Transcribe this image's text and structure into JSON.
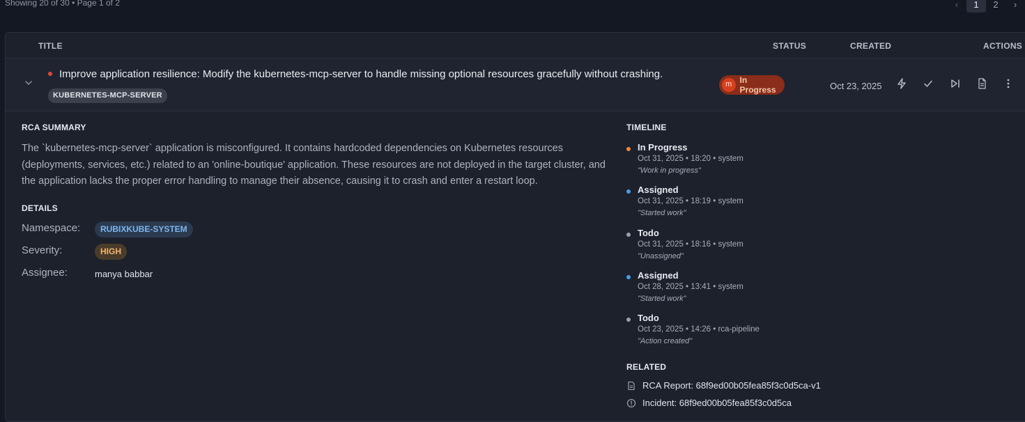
{
  "list_header": {
    "showing_text": "Showing 20 of 30 • Page 1 of 2",
    "pagination": {
      "prev": "‹",
      "pages": [
        "1",
        "2"
      ],
      "next": "›",
      "current": "1"
    }
  },
  "table": {
    "columns": {
      "title": "TITLE",
      "status": "STATUS",
      "created": "CREATED",
      "actions": "ACTIONS"
    }
  },
  "row": {
    "title": "Improve application resilience: Modify the kubernetes-mcp-server to handle missing optional resources gracefully without crashing.",
    "tag": "KUBERNETES-MCP-SERVER",
    "status": {
      "avatar_initial": "m",
      "label": "In Progress"
    },
    "created": "Oct 23, 2025",
    "actions": [
      "bolt-icon",
      "check-icon",
      "skip-forward-icon",
      "document-icon",
      "more-vertical-icon"
    ]
  },
  "details_panel": {
    "rca_summary_heading": "RCA SUMMARY",
    "rca_summary_text": "The `kubernetes-mcp-server` application is misconfigured. It contains hardcoded dependencies on Kubernetes resources (deployments, services, etc.) related to an 'online-boutique' application. These resources are not deployed in the target cluster, and the application lacks the proper error handling to manage their absence, causing it to crash and enter a restart loop.",
    "details_heading": "DETAILS",
    "namespace_label": "Namespace:",
    "namespace_value": "RUBIXKUBE-SYSTEM",
    "severity_label": "Severity:",
    "severity_value": "HIGH",
    "assignee_label": "Assignee:",
    "assignee_value": "manya babbar",
    "timeline_heading": "TIMELINE",
    "timeline": [
      {
        "status": "In Progress",
        "meta": "Oct 31, 2025 • 18:20 • system",
        "note": "\"Work in progress\"",
        "color": "#f0883e"
      },
      {
        "status": "Assigned",
        "meta": "Oct 31, 2025 • 18:19 • system",
        "note": "\"Started work\"",
        "color": "#4a9fe8"
      },
      {
        "status": "Todo",
        "meta": "Oct 31, 2025 • 18:16 • system",
        "note": "\"Unassigned\"",
        "color": "#9aa1ad"
      },
      {
        "status": "Assigned",
        "meta": "Oct 28, 2025 • 13:41 • system",
        "note": "\"Started work\"",
        "color": "#4a9fe8"
      },
      {
        "status": "Todo",
        "meta": "Oct 23, 2025 • 14:26 • rca-pipeline",
        "note": "\"Action created\"",
        "color": "#9aa1ad"
      }
    ],
    "related_heading": "RELATED",
    "related": [
      {
        "icon": "document-icon",
        "label": "RCA Report: 68f9ed00b05fea85f3c0d5ca-v1"
      },
      {
        "icon": "info-circle-icon",
        "label": "Incident: 68f9ed00b05fea85f3c0d5ca"
      }
    ]
  },
  "colors": {
    "background": "#141823",
    "panel": "#1c212c",
    "status_in_progress": "#8a2d1a",
    "severity_high": "#f1b571",
    "namespace": "#7cb7ee",
    "priority_dot": "#e0483e"
  }
}
